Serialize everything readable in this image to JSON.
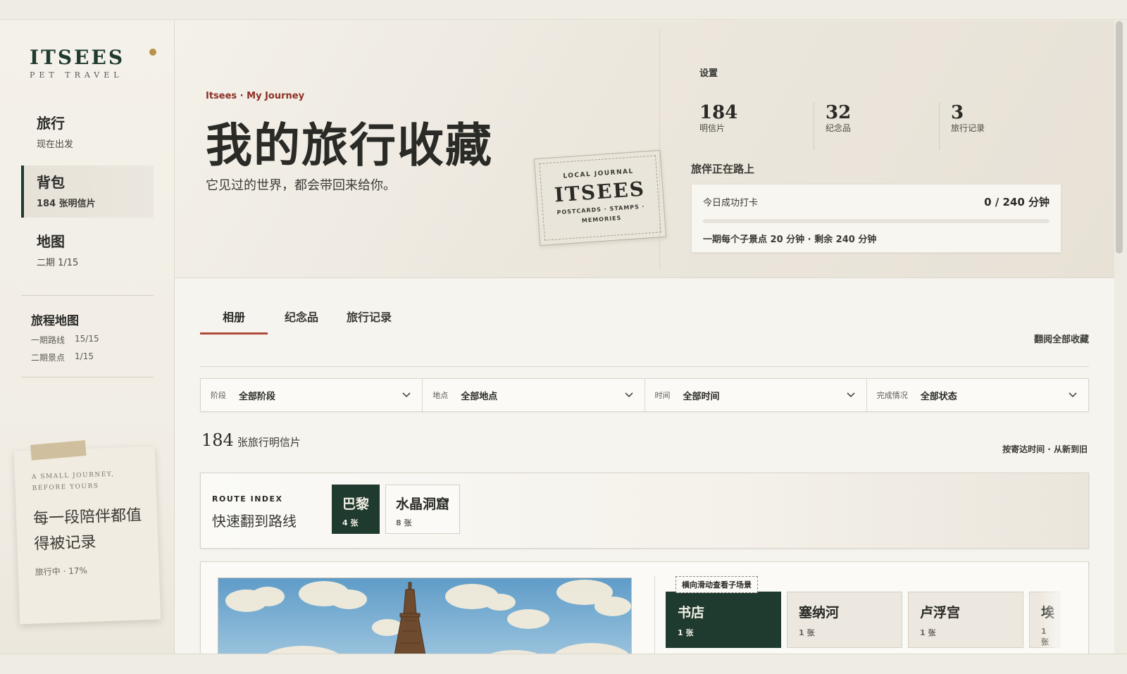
{
  "brand": {
    "logo": "ITSEES",
    "tagline": "PET TRAVEL"
  },
  "sidebar": {
    "nav": [
      {
        "label": "旅行",
        "sub": "现在出发"
      },
      {
        "label": "背包",
        "sub": "184 张明信片"
      },
      {
        "label": "地图",
        "sub": "二期 1/15"
      }
    ],
    "route_map": {
      "title": "旅程地图",
      "rows": [
        {
          "name": "一期路线",
          "value": "15/15"
        },
        {
          "name": "二期景点",
          "value": "1/15"
        }
      ]
    },
    "note": {
      "eyebrow_line1": "A SMALL JOURNEY,",
      "eyebrow_line2": "BEFORE YOURS",
      "quote": "每一段陪伴都值得被记录",
      "status": "旅行中 · 17%"
    }
  },
  "hero": {
    "eyebrow": "Itsees · My Journey",
    "title": "我的旅行收藏",
    "subtitle": "它见过的世界，都会带回来给你。",
    "stamp": {
      "top": "LOCAL JOURNAL",
      "main": "ITSEES",
      "bottom": "POSTCARDS · STAMPS · MEMORIES"
    },
    "settings": "设置",
    "stats": [
      {
        "value": "184",
        "label": "明信片"
      },
      {
        "value": "32",
        "label": "纪念品"
      },
      {
        "value": "3",
        "label": "旅行记录"
      }
    ],
    "companion": "旅伴正在路上",
    "checkin": {
      "title": "今日成功打卡",
      "value": "0 / 240 分钟",
      "progress": 0,
      "note": "一期每个子景点 20 分钟 · 剩余 240 分钟"
    }
  },
  "main": {
    "tabs": [
      "相册",
      "纪念品",
      "旅行记录"
    ],
    "browse_all": "翻阅全部收藏",
    "filters": [
      {
        "key": "阶段",
        "value": "全部阶段"
      },
      {
        "key": "地点",
        "value": "全部地点"
      },
      {
        "key": "时间",
        "value": "全部时间"
      },
      {
        "key": "完成情况",
        "value": "全部状态"
      }
    ],
    "count": {
      "number": "184",
      "label": "张旅行明信片"
    },
    "sort": "按寄达时间 · 从新到旧",
    "route_index": {
      "eyebrow": "ROUTE INDEX",
      "title": "快速翻到路线",
      "chips": [
        {
          "name": "巴黎",
          "count": "4 张"
        },
        {
          "name": "水晶洞窟",
          "count": "8 张"
        }
      ]
    },
    "place": {
      "scroll_hint": "横向滑动查看子场景",
      "sub_chips": [
        {
          "name": "书店",
          "count": "1 张"
        },
        {
          "name": "塞纳河",
          "count": "1 张"
        },
        {
          "name": "卢浮宫",
          "count": "1 张"
        },
        {
          "name": "埃",
          "count": "1 张"
        }
      ]
    }
  },
  "colors": {
    "accent_green": "#1f3a2e",
    "accent_red": "#b2473c",
    "gold_dot": "#b9924a"
  },
  "icons": [
    "chevron-down-icon"
  ]
}
